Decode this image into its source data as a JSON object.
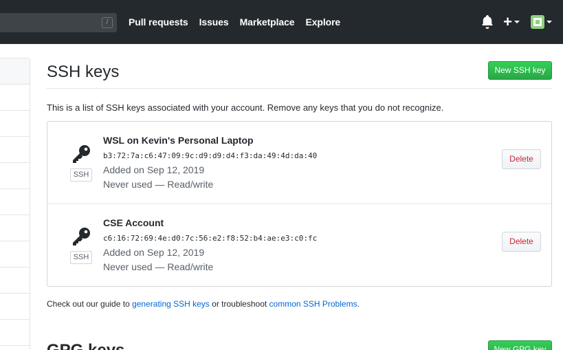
{
  "header": {
    "search_shortcut": "/",
    "nav": [
      "Pull requests",
      "Issues",
      "Marketplace",
      "Explore"
    ],
    "plus_label": "+",
    "icons": [
      "bell-icon",
      "plus-icon",
      "caret-down-icon",
      "avatar-identicon"
    ]
  },
  "main": {
    "title": "SSH keys",
    "new_button": "New SSH key",
    "description": "This is a list of SSH keys associated with your account. Remove any keys that you do not recognize.",
    "keys": [
      {
        "name": "WSL on Kevin's Personal Laptop",
        "fingerprint": "b3:72:7a:c6:47:09:9c:d9:d9:d4:f3:da:49:4d:da:40",
        "added": "Added on Sep 12, 2019",
        "usage": "Never used — Read/write",
        "badge": "SSH",
        "delete_label": "Delete"
      },
      {
        "name": "CSE Account",
        "fingerprint": "c6:16:72:69:4e:d0:7c:56:e2:f8:52:b4:ae:e3:c0:fc",
        "added": "Added on Sep 12, 2019",
        "usage": "Never used — Read/write",
        "badge": "SSH",
        "delete_label": "Delete"
      }
    ],
    "footer": {
      "prefix": "Check out our guide to ",
      "link1": "generating SSH keys",
      "middle": " or troubleshoot ",
      "link2": "common SSH Problems",
      "suffix": "."
    },
    "gpg_title": "GPG keys",
    "gpg_button": "New GPG key"
  },
  "colors": {
    "header_bg": "#24292e",
    "primary_green": "#28a745",
    "danger_red": "#cb2431",
    "link_blue": "#0366d6"
  }
}
